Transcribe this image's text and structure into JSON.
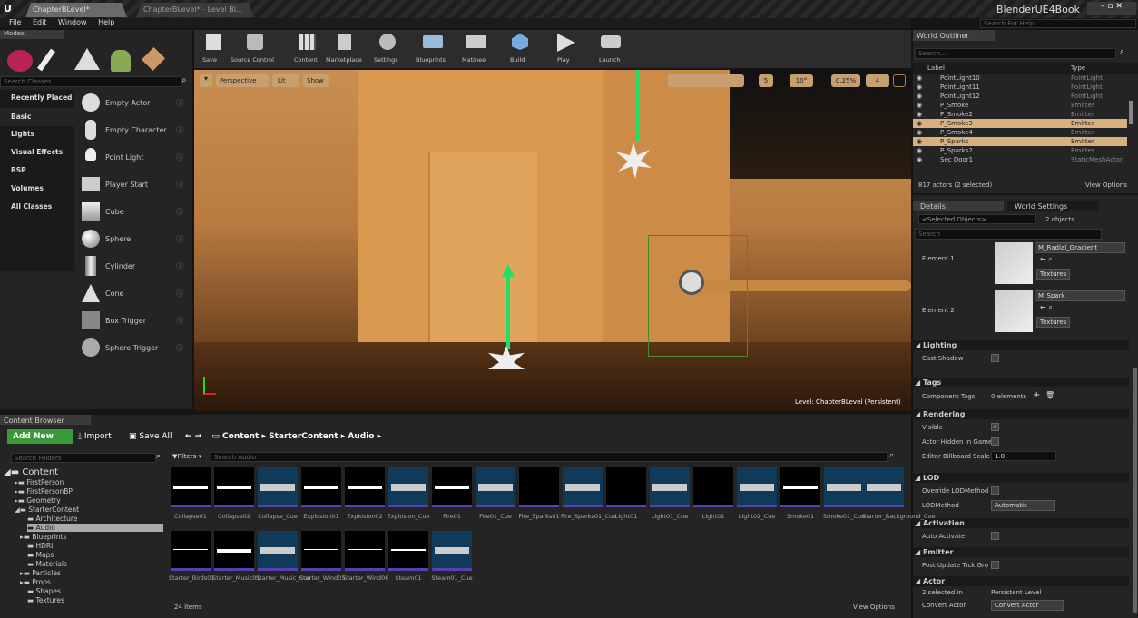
{
  "window": {
    "tabs": [
      "ChapterBLevel*",
      "ChapterBLevel* - Level Bl..."
    ],
    "app_title": "BlenderUE4Book",
    "search_help": "Search For Help"
  },
  "menu": [
    "File",
    "Edit",
    "Window",
    "Help"
  ],
  "modes": {
    "title": "Modes",
    "search_placeholder": "Search Classes",
    "categories": [
      "Recently Placed",
      "Basic",
      "Lights",
      "Visual Effects",
      "BSP",
      "Volumes",
      "All Classes"
    ],
    "items": [
      "Empty Actor",
      "Empty Character",
      "Point Light",
      "Player Start",
      "Cube",
      "Sphere",
      "Cylinder",
      "Cone",
      "Box Trigger",
      "Sphere Trigger"
    ]
  },
  "toolbar": [
    "Save",
    "Source Control",
    "Content",
    "Marketplace",
    "Settings",
    "Blueprints",
    "Matinee",
    "Build",
    "Play",
    "Launch"
  ],
  "viewport": {
    "perspective": "Perspective",
    "lit": "Lit",
    "show": "Show",
    "grid": "5",
    "angle": "10°",
    "scale": "0.25%",
    "cam_speed": "4",
    "level": "Level: ChapterBLevel (Persistent)"
  },
  "outliner": {
    "title": "World Outliner",
    "search_placeholder": "Search...",
    "col_label": "Label",
    "col_type": "Type",
    "rows": [
      [
        "PointLight10",
        "PointLight"
      ],
      [
        "PointLight11",
        "PointLight"
      ],
      [
        "PointLight12",
        "PointLight"
      ],
      [
        "P_Smoke",
        "Emitter"
      ],
      [
        "P_Smoke2",
        "Emitter"
      ],
      [
        "P_Smoke3",
        "Emitter"
      ],
      [
        "P_Smoke4",
        "Emitter"
      ],
      [
        "P_Sparks",
        "Emitter"
      ],
      [
        "P_Sparks2",
        "Emitter"
      ],
      [
        "Sec Door1",
        "StaticMeshActor"
      ]
    ],
    "count": "817 actors (2 selected)",
    "view_options": "View Options"
  },
  "details": {
    "tab1": "Details",
    "tab2": "World Settings",
    "selected": "<Selected Objects>",
    "objects": "2 objects",
    "search_placeholder": "Search",
    "element1": "Element 1",
    "mat1": "M_Radial_Gradient",
    "element2": "Element 2",
    "mat2": "M_Spark",
    "textures": "Textures",
    "lighting": "Lighting",
    "cast_shadow": "Cast Shadow",
    "tags": "Tags",
    "component_tags": "Component Tags",
    "elements": "0 elements",
    "rendering": "Rendering",
    "visible": "Visible",
    "hidden": "Actor Hidden In Game",
    "billboard": "Editor Billboard Scale",
    "billboard_val": "1.0",
    "lod": "LOD",
    "override_lod": "Override LODMethod",
    "lodmethod": "LODMethod",
    "lod_val": "Automatic",
    "activation": "Activation",
    "auto_activate": "Auto Activate",
    "emitter": "Emitter",
    "post_update": "Post Update Tick Gro",
    "actor": "Actor",
    "selected_in": "2 selected in",
    "persistent": "Persistent Level",
    "convert_actor": "Convert Actor",
    "convert_btn": "Convert Actor"
  },
  "content": {
    "title": "Content Browser",
    "add_new": "Add New",
    "import": "Import",
    "save_all": "Save All",
    "path": [
      "Content",
      "StarterContent",
      "Audio"
    ],
    "search_folders": "Search Folders",
    "filters": "Filters",
    "search_audio": "Search Audio",
    "tree": [
      "Content",
      "FirstPerson",
      "FirstPersonBP",
      "Geometry",
      "StarterContent",
      "Architecture",
      "Audio",
      "Blueprints",
      "HDRI",
      "Maps",
      "Materials",
      "Particles",
      "Props",
      "Shapes",
      "Textures"
    ],
    "assets": [
      "Collapse01",
      "Collapse02",
      "Collapse_Cue",
      "Explosion01",
      "Explosion02",
      "Explosion_Cue",
      "Fire01",
      "Fire01_Cue",
      "Fire_Sparks01",
      "Fire_Sparks01_Cue",
      "Light01",
      "Light01_Cue",
      "Light02",
      "Light02_Cue",
      "Smoke01",
      "Smoke01_Cue",
      "Starter_Background_Cue",
      "Starter_Birds01",
      "Starter_Music01",
      "Starter_Music_Cue",
      "Starter_Wind05",
      "Starter_Wind06",
      "Steam01",
      "Steam01_Cue"
    ],
    "count": "24 items",
    "view_options": "View Options"
  }
}
